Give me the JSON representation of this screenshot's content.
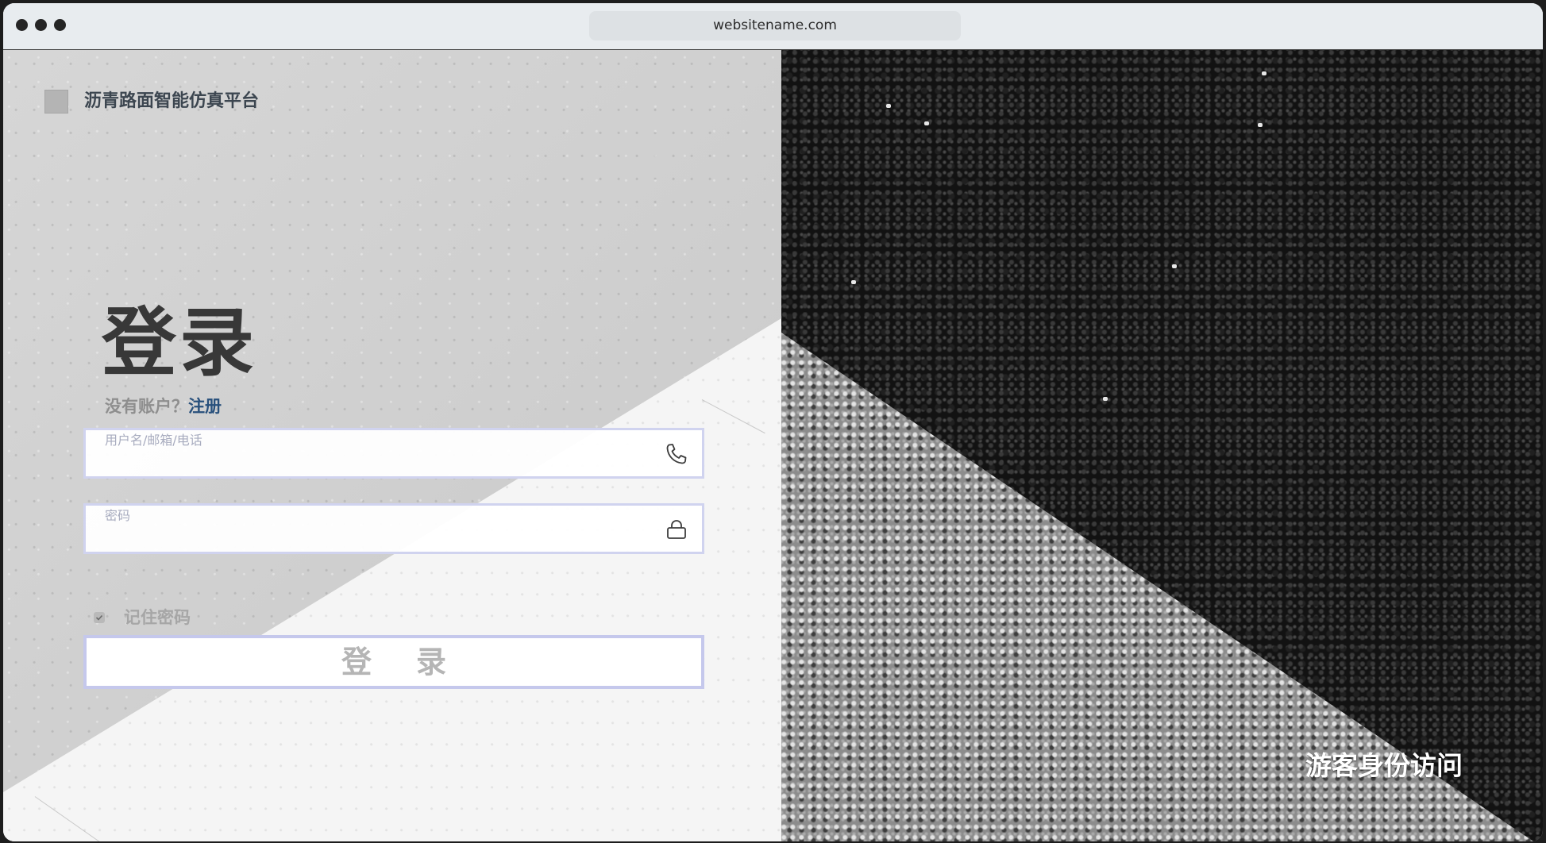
{
  "browser": {
    "url": "websitename.com"
  },
  "brand": {
    "title": "沥青路面智能仿真平台",
    "logo_icon": "logo-placeholder-icon"
  },
  "login": {
    "heading": "登录",
    "no_account_text": "没有账户？",
    "register_link": "注册",
    "username_label": "用户名/邮箱/电话",
    "username_value": "",
    "username_icon": "phone-icon",
    "password_label": "密码",
    "password_value": "",
    "password_icon": "lock-icon",
    "remember_label": "记住密码",
    "remember_checked": true,
    "submit_label": "登录"
  },
  "guest": {
    "link_label": "游客身份访问"
  },
  "colors": {
    "accent": "#28507c",
    "field_border": "#d0d3ef",
    "button_border": "#c5c8ec",
    "heading": "#383838"
  }
}
